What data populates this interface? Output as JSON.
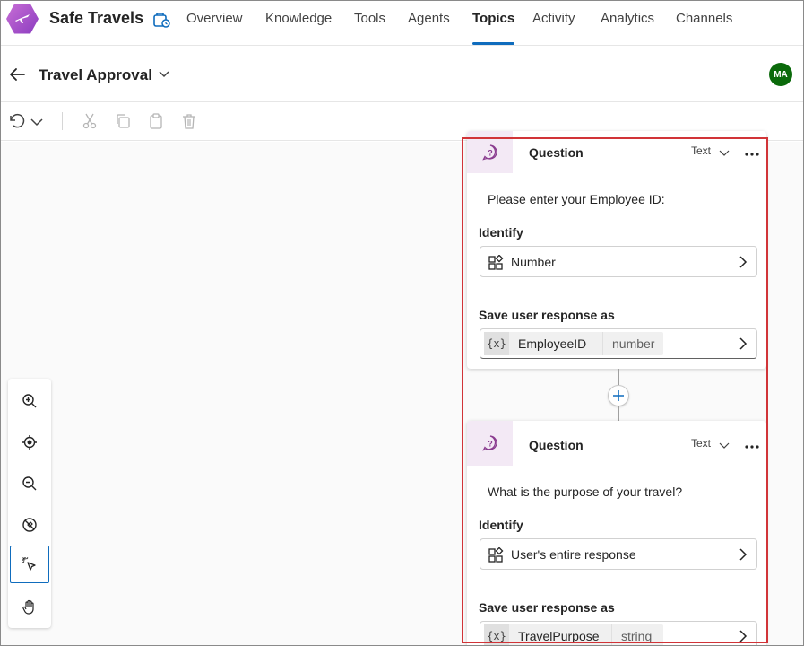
{
  "app": {
    "title": "Safe Travels",
    "nav_tabs": [
      {
        "label": "Overview"
      },
      {
        "label": "Knowledge"
      },
      {
        "label": "Tools"
      },
      {
        "label": "Agents"
      },
      {
        "label": "Topics",
        "active": true
      },
      {
        "label": "Activity"
      },
      {
        "label": "Analytics"
      },
      {
        "label": "Channels"
      }
    ]
  },
  "subheader": {
    "topic_title": "Travel Approval",
    "avatar_initials": "MA",
    "avatar_color": "#0b6a0b"
  },
  "toolbar": {
    "icons": [
      "undo-icon",
      "chevron-down-icon",
      "cut-icon",
      "copy-icon",
      "paste-icon",
      "delete-icon"
    ]
  },
  "zoom_controls": [
    "zoom-in-icon",
    "recenter-icon",
    "zoom-out-icon",
    "minimap-off-icon",
    "select-pointer-icon",
    "pan-hand-icon"
  ],
  "cards": [
    {
      "type": "Question",
      "format": "Text",
      "prompt": "Please enter your Employee ID:",
      "identify_label": "Identify",
      "identify_value": "Number",
      "save_label": "Save user response as",
      "var_symbol": "{x}",
      "var_name": "EmployeeID",
      "var_type": "number"
    },
    {
      "type": "Question",
      "format": "Text",
      "prompt": "What is the purpose of your travel?",
      "identify_label": "Identify",
      "identify_value": "User's entire response",
      "save_label": "Save user response as",
      "var_symbol": "{x}",
      "var_name": "TravelPurpose",
      "var_type": "string"
    }
  ],
  "colors": {
    "accent": "#0f6cbd",
    "highlight": "#d13438",
    "question_icon": "#8a3b8f"
  }
}
